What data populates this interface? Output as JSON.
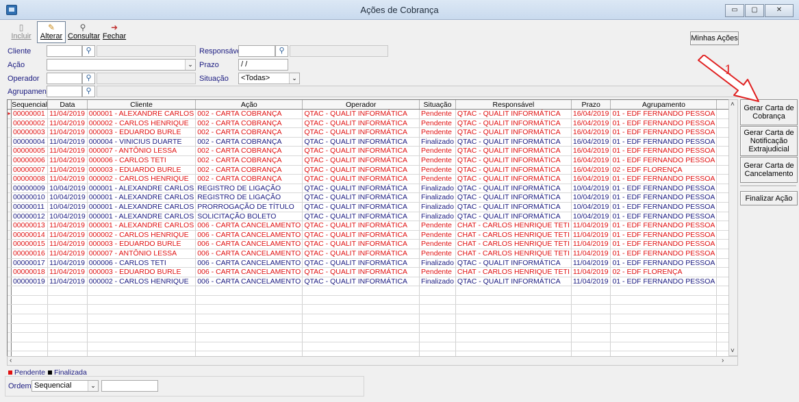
{
  "window": {
    "title": "Ações de Cobrança",
    "buttons": [
      "▭",
      "▢",
      "✕"
    ]
  },
  "toolbar": [
    {
      "label": "Incluir",
      "icon": "new-doc-icon",
      "state": "disabled"
    },
    {
      "label": "Alterar",
      "icon": "edit-icon",
      "state": "active"
    },
    {
      "label": "Consultar",
      "icon": "binoculars-icon",
      "state": "normal"
    },
    {
      "label": "Fechar",
      "icon": "exit-door-icon",
      "state": "normal"
    }
  ],
  "filters": {
    "cliente_label": "Cliente",
    "acao_label": "Ação",
    "operador_label": "Operador",
    "agrupamento_label": "Agrupamento",
    "responsavel_label": "Responsável",
    "prazo_label": "Prazo",
    "prazo_value": " / /",
    "situacao_label": "Situação",
    "situacao_value": "<Todas>"
  },
  "side_buttons": {
    "minhas_acoes": "Minhas Ações",
    "gerar_cobranca": [
      "Gerar Carta de",
      "Cobrança"
    ],
    "gerar_notificacao": [
      "Gerar Carta de",
      "Notificação",
      "Extrajudicial"
    ],
    "gerar_cancelamento": [
      "Gerar Carta de",
      "Cancelamento"
    ],
    "finalizar": "Finalizar Ação"
  },
  "annotation": {
    "number": "1",
    "arrow_color": "#e02020"
  },
  "grid": {
    "columns": [
      "Sequencial",
      "Data",
      "Cliente",
      "Ação",
      "Operador",
      "Situação",
      "Responsável",
      "Prazo",
      "Agrupamento"
    ],
    "rows": [
      {
        "status": "p",
        "cells": [
          "00000001",
          "11/04/2019",
          "000001 - ALEXANDRE CARLOS",
          "002 - CARTA COBRANÇA",
          "QTAC - QUALIT INFORMÁTICA",
          "Pendente",
          "QTAC - QUALIT INFORMÁTICA",
          "16/04/2019",
          "01 - EDF FERNANDO PESSOA"
        ]
      },
      {
        "status": "p",
        "cells": [
          "00000002",
          "11/04/2019",
          "000002 - CARLOS HENRIQUE",
          "002 - CARTA COBRANÇA",
          "QTAC - QUALIT INFORMÁTICA",
          "Pendente",
          "QTAC - QUALIT INFORMÁTICA",
          "16/04/2019",
          "01 - EDF FERNANDO PESSOA"
        ]
      },
      {
        "status": "p",
        "cells": [
          "00000003",
          "11/04/2019",
          "000003 - EDUARDO BURLE",
          "002 - CARTA COBRANÇA",
          "QTAC - QUALIT INFORMÁTICA",
          "Pendente",
          "QTAC - QUALIT INFORMÁTICA",
          "16/04/2019",
          "01 - EDF FERNANDO PESSOA"
        ]
      },
      {
        "status": "f",
        "cells": [
          "00000004",
          "11/04/2019",
          "000004 - VINICIUS DUARTE",
          "002 - CARTA COBRANÇA",
          "QTAC - QUALIT INFORMÁTICA",
          "Finalizado",
          "QTAC - QUALIT INFORMÁTICA",
          "16/04/2019",
          "01 - EDF FERNANDO PESSOA"
        ]
      },
      {
        "status": "p",
        "cells": [
          "00000005",
          "11/04/2019",
          "000007 - ANTÔNIO LESSA",
          "002 - CARTA COBRANÇA",
          "QTAC - QUALIT INFORMÁTICA",
          "Pendente",
          "QTAC - QUALIT INFORMÁTICA",
          "16/04/2019",
          "01 - EDF FERNANDO PESSOA"
        ]
      },
      {
        "status": "p",
        "cells": [
          "00000006",
          "11/04/2019",
          "000006 - CARLOS TETI",
          "002 - CARTA COBRANÇA",
          "QTAC - QUALIT INFORMÁTICA",
          "Pendente",
          "QTAC - QUALIT INFORMÁTICA",
          "16/04/2019",
          "01 - EDF FERNANDO PESSOA"
        ]
      },
      {
        "status": "p",
        "cells": [
          "00000007",
          "11/04/2019",
          "000003 - EDUARDO BURLE",
          "002 - CARTA COBRANÇA",
          "QTAC - QUALIT INFORMÁTICA",
          "Pendente",
          "QTAC - QUALIT INFORMÁTICA",
          "16/04/2019",
          "02 - EDF FLORENÇA"
        ]
      },
      {
        "status": "p",
        "cells": [
          "00000008",
          "11/04/2019",
          "000002 - CARLOS HENRIQUE",
          "002 - CARTA COBRANÇA",
          "QTAC - QUALIT INFORMÁTICA",
          "Pendente",
          "QTAC - QUALIT INFORMÁTICA",
          "16/04/2019",
          "01 - EDF FERNANDO PESSOA"
        ]
      },
      {
        "status": "f",
        "cells": [
          "00000009",
          "10/04/2019",
          "000001 - ALEXANDRE CARLOS",
          "REGISTRO DE LIGAÇÃO",
          "QTAC - QUALIT INFORMÁTICA",
          "Finalizado",
          "QTAC - QUALIT INFORMÁTICA",
          "10/04/2019",
          "01 - EDF FERNANDO PESSOA"
        ]
      },
      {
        "status": "f",
        "cells": [
          "00000010",
          "10/04/2019",
          "000001 - ALEXANDRE CARLOS",
          "REGISTRO DE LIGAÇÃO",
          "QTAC - QUALIT INFORMÁTICA",
          "Finalizado",
          "QTAC - QUALIT INFORMÁTICA",
          "10/04/2019",
          "01 - EDF FERNANDO PESSOA"
        ]
      },
      {
        "status": "f",
        "cells": [
          "00000011",
          "10/04/2019",
          "000001 - ALEXANDRE CARLOS",
          "PRORROGAÇÃO DE TÍTULO",
          "QTAC - QUALIT INFORMÁTICA",
          "Finalizado",
          "QTAC - QUALIT INFORMÁTICA",
          "10/04/2019",
          "01 - EDF FERNANDO PESSOA"
        ]
      },
      {
        "status": "f",
        "cells": [
          "00000012",
          "10/04/2019",
          "000001 - ALEXANDRE CARLOS",
          "SOLICITAÇÃO BOLETO",
          "QTAC - QUALIT INFORMÁTICA",
          "Finalizado",
          "QTAC - QUALIT INFORMÁTICA",
          "10/04/2019",
          "01 - EDF FERNANDO PESSOA"
        ]
      },
      {
        "status": "p",
        "cells": [
          "00000013",
          "11/04/2019",
          "000001 - ALEXANDRE CARLOS",
          "006 - CARTA CANCELAMENTO",
          "QTAC - QUALIT INFORMÁTICA",
          "Pendente",
          "CHAT - CARLOS HENRIQUE TETI",
          "11/04/2019",
          "01 - EDF FERNANDO PESSOA"
        ]
      },
      {
        "status": "p",
        "cells": [
          "00000014",
          "11/04/2019",
          "000002 - CARLOS HENRIQUE",
          "006 - CARTA CANCELAMENTO",
          "QTAC - QUALIT INFORMÁTICA",
          "Pendente",
          "CHAT - CARLOS HENRIQUE TETI",
          "11/04/2019",
          "01 - EDF FERNANDO PESSOA"
        ]
      },
      {
        "status": "p",
        "cells": [
          "00000015",
          "11/04/2019",
          "000003 - EDUARDO BURLE",
          "006 - CARTA CANCELAMENTO",
          "QTAC - QUALIT INFORMÁTICA",
          "Pendente",
          "CHAT - CARLOS HENRIQUE TETI",
          "11/04/2019",
          "01 - EDF FERNANDO PESSOA"
        ]
      },
      {
        "status": "p",
        "cells": [
          "00000016",
          "11/04/2019",
          "000007 - ANTÔNIO LESSA",
          "006 - CARTA CANCELAMENTO",
          "QTAC - QUALIT INFORMÁTICA",
          "Pendente",
          "CHAT - CARLOS HENRIQUE TETI",
          "11/04/2019",
          "01 - EDF FERNANDO PESSOA"
        ]
      },
      {
        "status": "f",
        "cells": [
          "00000017",
          "11/04/2019",
          "000006 - CARLOS TETI",
          "006 - CARTA CANCELAMENTO",
          "QTAC - QUALIT INFORMÁTICA",
          "Finalizado",
          "QTAC - QUALIT INFORMÁTICA",
          "11/04/2019",
          "01 - EDF FERNANDO PESSOA"
        ]
      },
      {
        "status": "p",
        "cells": [
          "00000018",
          "11/04/2019",
          "000003 - EDUARDO BURLE",
          "006 - CARTA CANCELAMENTO",
          "QTAC - QUALIT INFORMÁTICA",
          "Pendente",
          "CHAT - CARLOS HENRIQUE TETI",
          "11/04/2019",
          "02 - EDF FLORENÇA"
        ]
      },
      {
        "status": "f",
        "cells": [
          "00000019",
          "11/04/2019",
          "000002 - CARLOS HENRIQUE",
          "006 - CARTA CANCELAMENTO",
          "QTAC - QUALIT INFORMÁTICA",
          "Finalizado",
          "QTAC - QUALIT INFORMÁTICA",
          "11/04/2019",
          "01 - EDF FERNANDO PESSOA"
        ]
      }
    ],
    "empty_rows": 8
  },
  "legend": {
    "pendente": "Pendente",
    "finalizada": "Finalizada",
    "pendente_color": "#e01010",
    "finalizada_color": "#000000"
  },
  "order": {
    "label": "Ordem",
    "value": "Sequencial"
  }
}
